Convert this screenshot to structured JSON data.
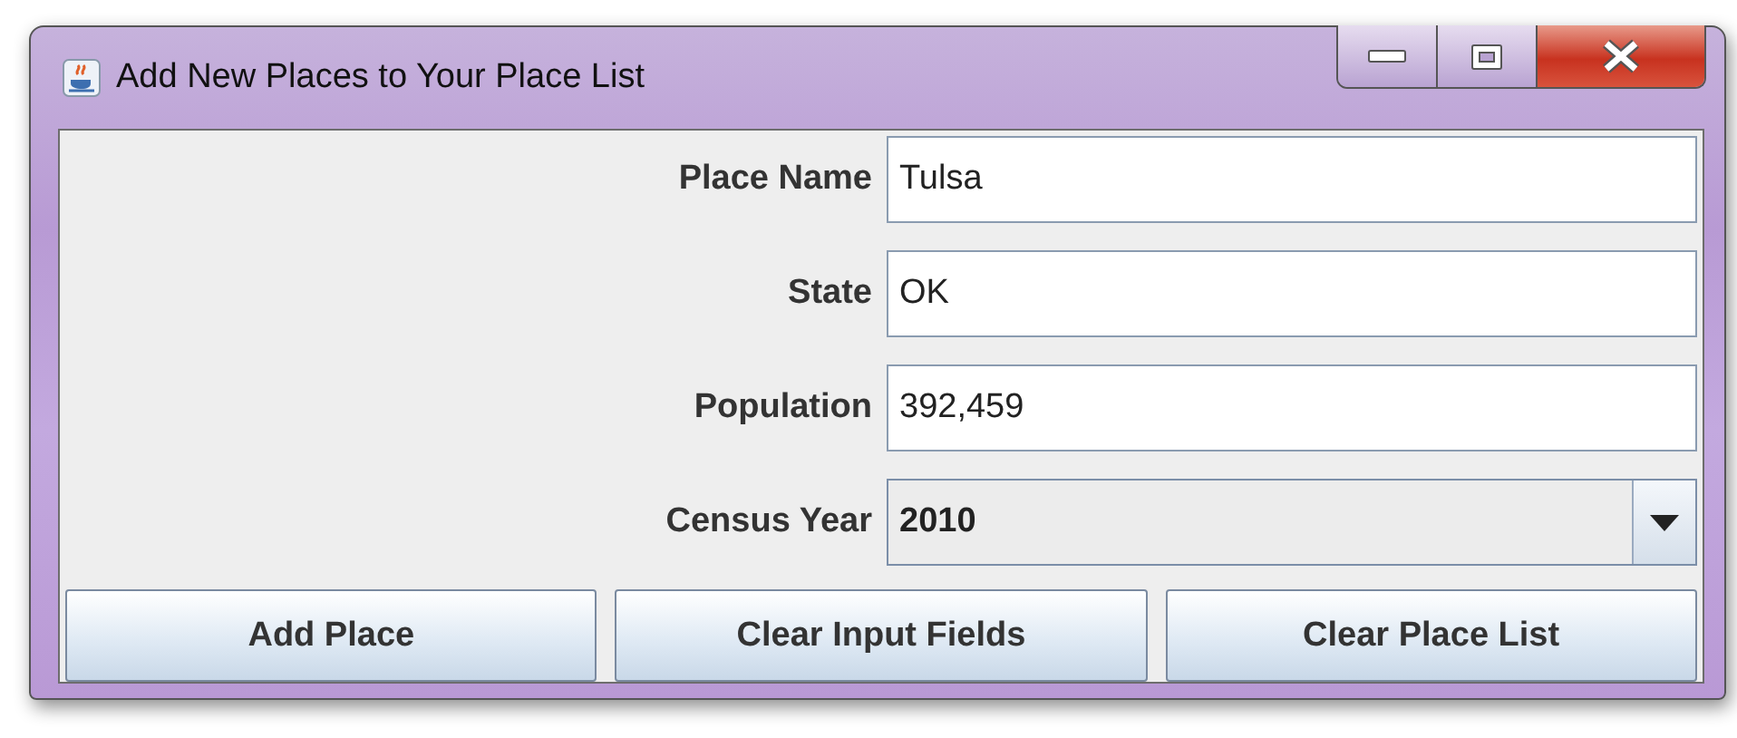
{
  "window": {
    "title": "Add New Places to Your Place List"
  },
  "fields": [
    {
      "kind": "text",
      "label": "Place Name",
      "value": "Tulsa"
    },
    {
      "kind": "text",
      "label": "State",
      "value": "OK"
    },
    {
      "kind": "text",
      "label": "Population",
      "value": "392,459"
    },
    {
      "kind": "combo",
      "label": "Census Year",
      "value": "2010"
    }
  ],
  "buttons": [
    "Add Place",
    "Clear Input Fields",
    "Clear Place List"
  ]
}
